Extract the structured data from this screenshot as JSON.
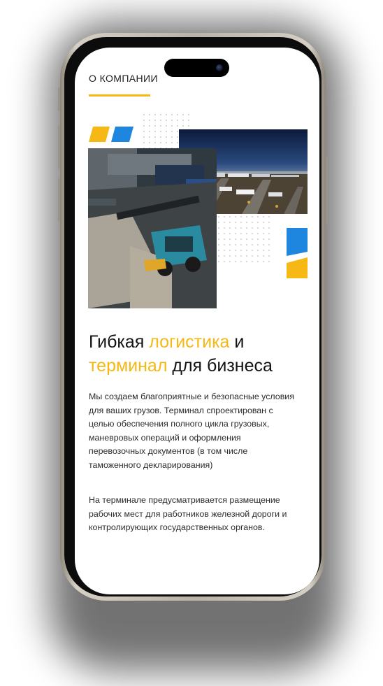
{
  "section": {
    "label": "О КОМПАНИИ"
  },
  "headline": {
    "part1": "Гибкая ",
    "highlight1": "логистика",
    "part2": " и",
    "highlight2": "терминал",
    "part3": " для бизнеса"
  },
  "paragraphs": [
    "Мы создаем благоприятные и безопасные условия для ваших грузов. Терминал спроектирован с целью обеспечения полного цикла грузовых, маневровых операций и оформления перевозочных документов (в том числе таможенного декларирования)",
    "На терминале предусматривается размещение рабочих мест для работников железной дороги и контролирующих государственных органов."
  ],
  "colors": {
    "accent_yellow": "#f6b815",
    "accent_blue": "#1f86e0",
    "text": "#121212"
  }
}
